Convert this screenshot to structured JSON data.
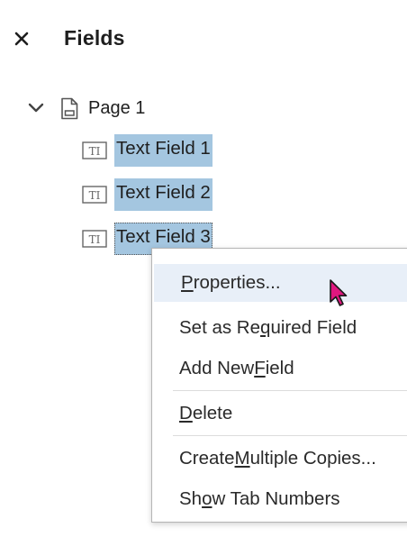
{
  "panel": {
    "title": "Fields",
    "close_glyph": "✕"
  },
  "tree": {
    "page": {
      "label": "Page 1",
      "expanded": true,
      "icon": "page-icon"
    },
    "fields": [
      {
        "label": "Text Field 1",
        "icon": "text-field-icon",
        "selected": true
      },
      {
        "label": "Text Field 2",
        "icon": "text-field-icon",
        "selected": true
      },
      {
        "label": "Text Field 3",
        "icon": "text-field-icon",
        "selected": true,
        "focused": true
      }
    ]
  },
  "context_menu": {
    "items": [
      {
        "pre": "",
        "key": "P",
        "post": "roperties...",
        "highlighted": true
      },
      {
        "pre": "Set as Re",
        "key": "q",
        "post": "uired Field"
      },
      {
        "pre": "Add New ",
        "key": "F",
        "post": "ield"
      },
      {
        "pre": "",
        "key": "D",
        "post": "elete"
      },
      {
        "pre": "Create ",
        "key": "M",
        "post": "ultiple Copies..."
      },
      {
        "pre": "Sh",
        "key": "o",
        "post": "w Tab Numbers"
      }
    ]
  },
  "colors": {
    "selection": "#a4c6e0",
    "menu_highlight": "#e8eff8",
    "cursor": "#e0177f"
  },
  "icons": {
    "close": "close-icon",
    "chevron": "chevron-down-icon",
    "cursor": "mouse-pointer-icon"
  }
}
